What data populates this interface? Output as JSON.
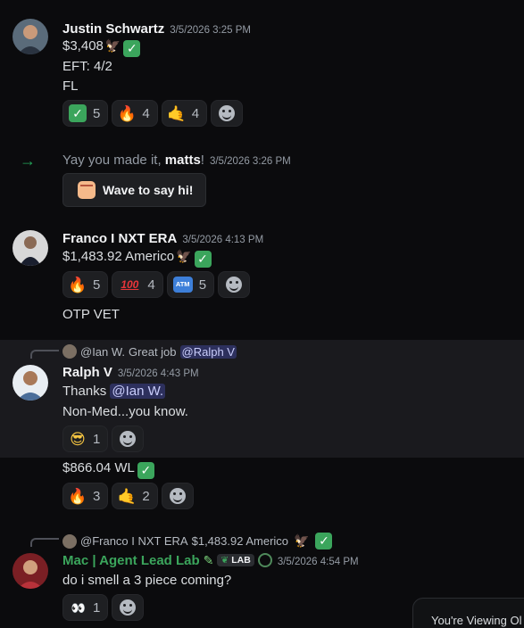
{
  "messages": [
    {
      "author": "Justin Schwartz",
      "timestamp": "3/5/2026 3:25 PM",
      "lines": [
        "$3,408",
        "EFT: 4/2",
        "FL"
      ],
      "reactions": [
        {
          "emoji": "check-mark",
          "count": "5"
        },
        {
          "emoji": "fire",
          "count": "4"
        },
        {
          "emoji": "call-me-hand",
          "count": "4"
        }
      ]
    },
    {
      "system_text_before": "Yay you made it, ",
      "system_user": "matts",
      "system_text_after": "!",
      "timestamp": "3/5/2026 3:26 PM",
      "button_label": "Wave to say hi!"
    },
    {
      "author": "Franco I NXT ERA",
      "timestamp": "3/5/2026 4:13 PM",
      "lines": [
        "$1,483.92 Americo",
        "OTP VET"
      ],
      "reactions": [
        {
          "emoji": "fire",
          "count": "5"
        },
        {
          "emoji": "hundred-points",
          "count": "4"
        },
        {
          "emoji": "atm",
          "count": "5"
        }
      ]
    },
    {
      "reply_to": "@Ian W.",
      "reply_text": " Great job ",
      "reply_mention": "@Ralph V",
      "author": "Ralph V",
      "timestamp": "3/5/2026 4:43 PM",
      "line1_text": "Thanks ",
      "line1_mention": "@Ian W.",
      "line2": "Non-Med...you know.",
      "reactions": [
        {
          "emoji": "sunglasses-face",
          "count": "1"
        }
      ]
    },
    {
      "line": "$866.04 WL",
      "reactions": [
        {
          "emoji": "fire",
          "count": "3"
        },
        {
          "emoji": "call-me-hand",
          "count": "2"
        }
      ]
    },
    {
      "reply_to": "@Franco I NXT ERA",
      "reply_text": " $1,483.92 Americo",
      "author": "Mac | Agent Lead Lab",
      "tag": "LAB",
      "timestamp": "3/5/2026 4:54 PM",
      "line": "do i smell a 3 piece coming?",
      "reactions": [
        {
          "emoji": "eyes",
          "count": "1"
        }
      ]
    }
  ],
  "viewing_banner": "You're Viewing Ol",
  "emoji_glyphs": {
    "check": "✓",
    "fire": "🔥",
    "call": "🤙",
    "hundred": "100",
    "atm": "ATM",
    "sunglasses": "😎",
    "eyes": "👀",
    "eagle": "🦅"
  },
  "colors": {
    "background": "#0b0b0d",
    "accent_green": "#3ba55c",
    "mention_bg": "#5865f2"
  }
}
